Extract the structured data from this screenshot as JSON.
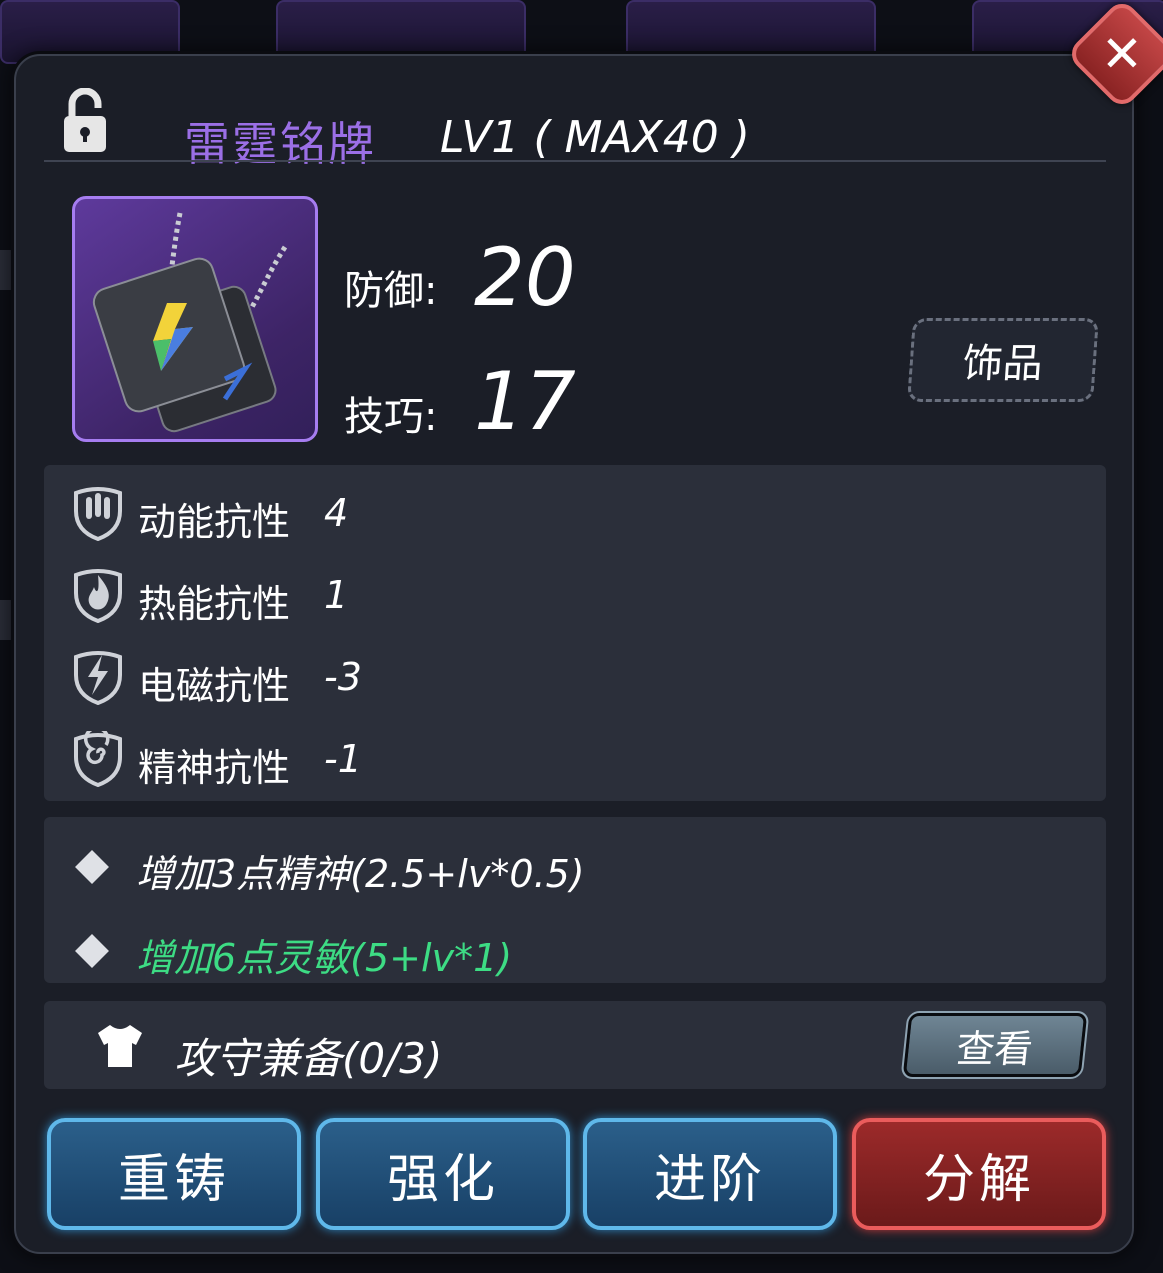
{
  "item": {
    "name": "雷霆铭牌",
    "level": "LV1 ( MAX40 )",
    "type": "饰品",
    "rarity_color": "#9b6fe6"
  },
  "stats": [
    {
      "label": "防御:",
      "value": "20"
    },
    {
      "label": "技巧:",
      "value": "17"
    }
  ],
  "resistances": [
    {
      "icon": "bullet-shield-icon",
      "label": "动能抗性",
      "value": "4"
    },
    {
      "icon": "fire-shield-icon",
      "label": "热能抗性",
      "value": "1"
    },
    {
      "icon": "lightning-shield-icon",
      "label": "电磁抗性",
      "value": "-3"
    },
    {
      "icon": "spiral-shield-icon",
      "label": "精神抗性",
      "value": "-1"
    }
  ],
  "bonuses": [
    {
      "text": "增加3点精神(2.5+lv*0.5)",
      "color": "#ffffff"
    },
    {
      "text": "增加6点灵敏(5+lv*1)",
      "color": "#3ddc84"
    }
  ],
  "set": {
    "icon": "shirt-icon",
    "label": "攻守兼备(0/3)",
    "view_label": "查看"
  },
  "actions": {
    "recast": "重铸",
    "enhance": "强化",
    "advance": "进阶",
    "dismantle": "分解"
  }
}
